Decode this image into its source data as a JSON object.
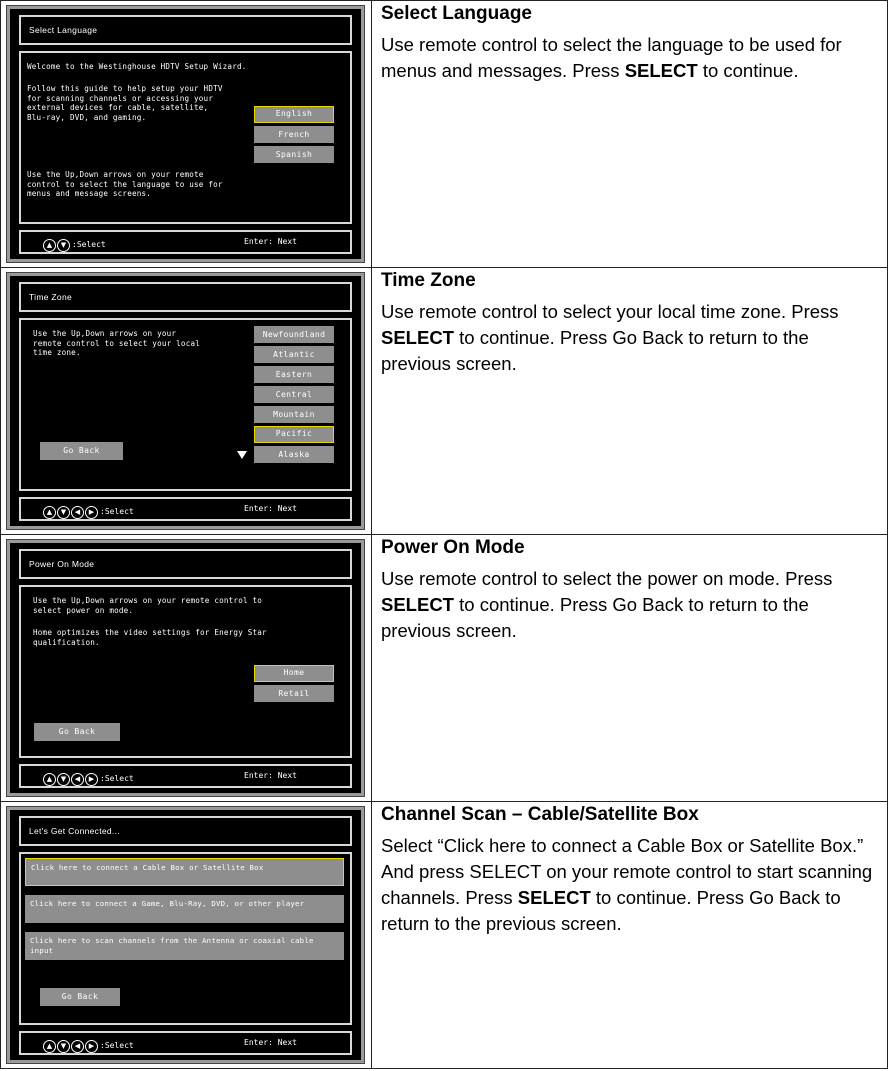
{
  "rows": [
    {
      "screen": {
        "title": "Select Language",
        "text1": "Welcome to the Westinghouse HDTV Setup Wizard.",
        "text2": "Follow this guide to help setup your HDTV for scanning channels or accessing your external devices for cable, satellite, Blu-ray, DVD, and gaming.",
        "text3": "Use the Up,Down arrows on your remote control to select the language to use for menus and message screens.",
        "options": [
          "English",
          "French",
          "Spanish"
        ],
        "selected_option": "English",
        "footer_select": ":Select",
        "footer_next": "Enter: Next"
      },
      "heading": "Select Language",
      "body_pre": "Use remote control to select the language to be used for menus and messages. Press ",
      "body_bold": "SELECT",
      "body_post": " to continue."
    },
    {
      "screen": {
        "title": "Time Zone",
        "text1": "Use the Up,Down arrows on your remote control to select your local time zone.",
        "options": [
          "Newfoundland",
          "Atlantic",
          "Eastern",
          "Central",
          "Mountain",
          "Pacific",
          "Alaska"
        ],
        "selected_option": "Pacific",
        "go_back": "Go Back",
        "footer_select": ":Select",
        "footer_next": "Enter: Next"
      },
      "heading": "Time Zone",
      "body_pre": "Use remote control to select your local time zone. Press ",
      "body_bold": "SELECT",
      "body_post": " to continue. Press Go Back to return to the previous screen."
    },
    {
      "screen": {
        "title": "Power On Mode",
        "text1": "Use the Up,Down arrows on your remote control to select power on mode.",
        "text2": "Home optimizes the video settings for Energy Star qualification.",
        "options": [
          "Home",
          "Retail"
        ],
        "selected_option": "Home",
        "go_back": "Go Back",
        "footer_select": ":Select",
        "footer_next": "Enter: Next"
      },
      "heading": "Power On Mode",
      "body_pre": "Use remote control to select the power on mode. Press ",
      "body_bold": "SELECT",
      "body_post": " to continue. Press Go Back to return to the previous screen."
    },
    {
      "screen": {
        "title": "Let's Get Connected...",
        "options": [
          "Click here to connect a Cable Box or Satellite Box",
          "Click here to connect a Game, Blu-Ray, DVD, or other player",
          "Click here to scan channels from the Antenna or coaxial cable input"
        ],
        "selected_option": "Click here to connect a Cable Box or Satellite Box",
        "go_back": "Go Back",
        "footer_select": ":Select",
        "footer_next": "Enter: Next"
      },
      "heading": "Channel Scan – Cable/Satellite Box",
      "body_pre": "Select “Click here to connect a Cable Box or Satellite Box.” And press SELECT on your remote control to start scanning channels. Press ",
      "body_bold": "SELECT",
      "body_post": " to continue. Press Go Back to return to the previous screen."
    }
  ],
  "icons": {
    "up": "up-arrow-icon",
    "down": "down-arrow-icon",
    "left": "left-arrow-icon",
    "right": "right-arrow-icon",
    "scroll": "scroll-down-triangle-icon"
  },
  "colors": {
    "screen_bg": "#000000",
    "button_bg": "#8e8e8e",
    "selected_border": "#e8d800"
  }
}
